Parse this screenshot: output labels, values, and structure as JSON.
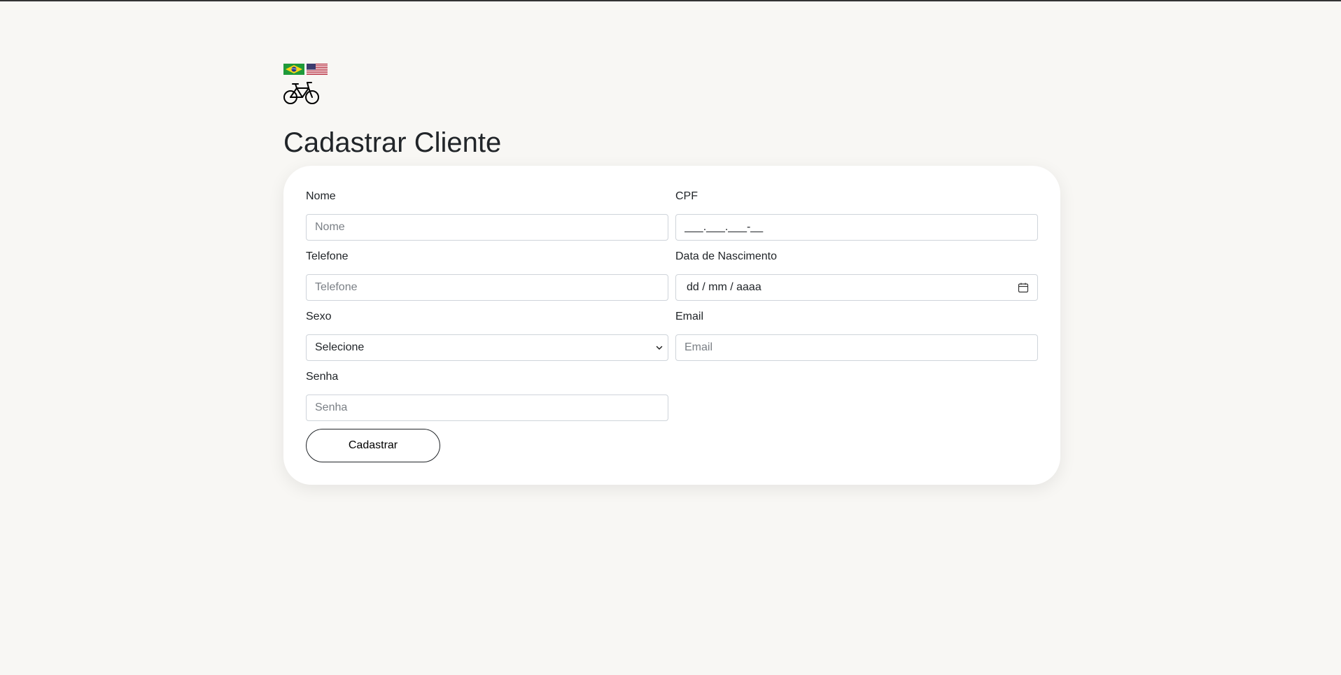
{
  "page": {
    "title": "Cadastrar Cliente"
  },
  "header": {
    "flags": [
      "brazil-flag-icon",
      "usa-flag-icon"
    ],
    "logo_icon": "bicycle-icon"
  },
  "form": {
    "nome": {
      "label": "Nome",
      "placeholder": "Nome"
    },
    "cpf": {
      "label": "CPF",
      "placeholder": "___.___.___-__"
    },
    "telefone": {
      "label": "Telefone",
      "placeholder": "Telefone"
    },
    "data_nascimento": {
      "label": "Data de Nascimento",
      "placeholder": "dd / mm / aaaa"
    },
    "sexo": {
      "label": "Sexo",
      "selected": "Selecione"
    },
    "email": {
      "label": "Email",
      "placeholder": "Email"
    },
    "senha": {
      "label": "Senha",
      "placeholder": "Senha"
    },
    "submit_label": "Cadastrar"
  }
}
